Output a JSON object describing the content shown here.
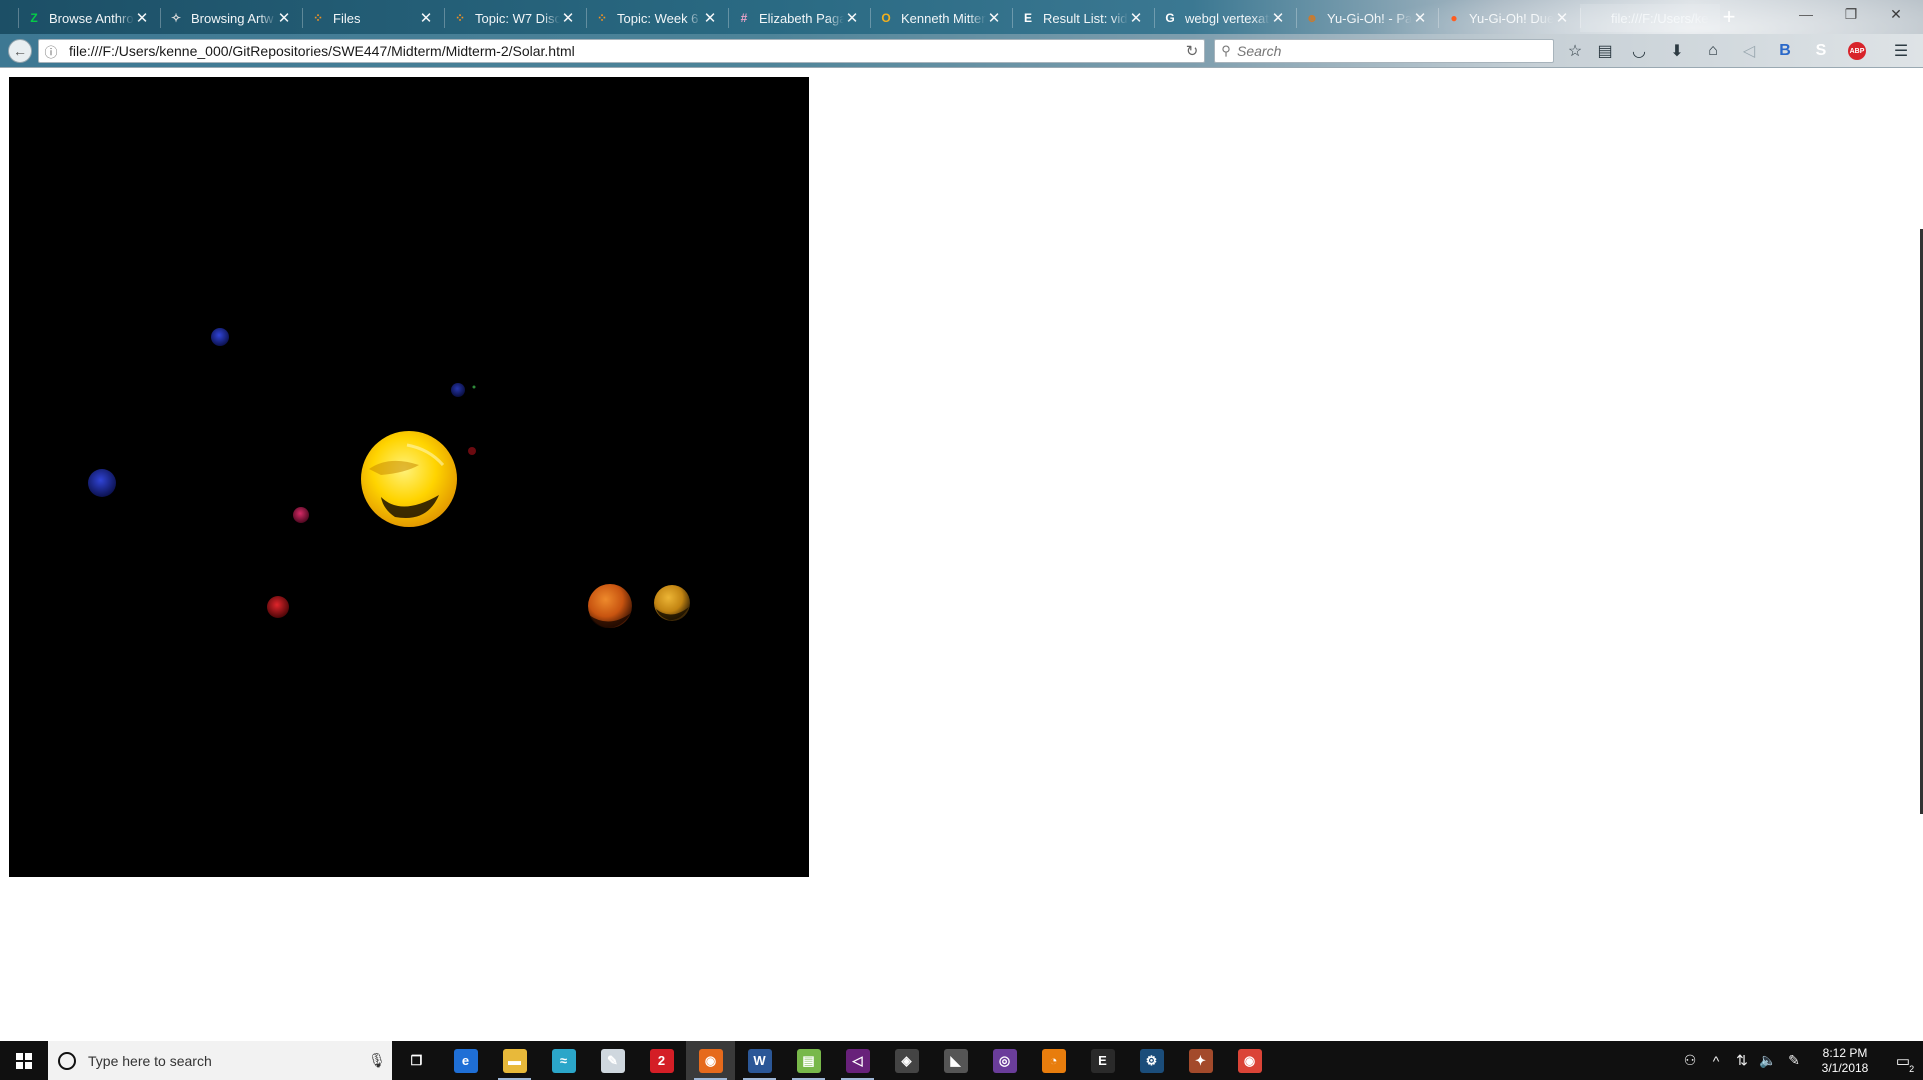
{
  "browser": {
    "tabs": [
      {
        "title": "Browse Anthro",
        "favicon": "deviantart-icon",
        "fav_glyph": "Z",
        "fav_color": "#05cc47",
        "active": false
      },
      {
        "title": "Browsing Artw",
        "favicon": "furaffinity-icon",
        "fav_glyph": "✧",
        "fav_color": "#dddddd",
        "active": false
      },
      {
        "title": "Files",
        "favicon": "d2l-icon",
        "fav_glyph": "⁘",
        "fav_color": "#f29222",
        "active": false
      },
      {
        "title": "Topic: W7 Disc",
        "favicon": "d2l-icon",
        "fav_glyph": "⁘",
        "fav_color": "#f29222",
        "active": false
      },
      {
        "title": "Topic: Week 6",
        "favicon": "d2l-icon",
        "fav_glyph": "⁘",
        "fav_color": "#f29222",
        "active": false
      },
      {
        "title": "Elizabeth Pagan",
        "favicon": "slack-icon",
        "fav_glyph": "#",
        "fav_color": "#e8a2c8",
        "active": false
      },
      {
        "title": "Kenneth Mitten",
        "favicon": "outlook-icon",
        "fav_glyph": "O",
        "fav_color": "#f2b01e",
        "active": false
      },
      {
        "title": "Result List: vid",
        "favicon": "ebsco-icon",
        "fav_glyph": "E",
        "fav_color": "#ffffff",
        "active": false
      },
      {
        "title": "webgl vertexatt",
        "favicon": "google-icon",
        "fav_glyph": "G",
        "fav_color": "#ffffff",
        "active": false
      },
      {
        "title": "Yu-Gi-Oh! - Pa",
        "favicon": "yugioh-icon",
        "fav_glyph": "☻",
        "fav_color": "#c97b2f",
        "active": false
      },
      {
        "title": "Yu-Gi-Oh! Due",
        "favicon": "reddit-icon",
        "fav_glyph": "●",
        "fav_color": "#ff4500",
        "active": false
      },
      {
        "title": "file:///F:/Users/ke",
        "favicon": "",
        "fav_glyph": "",
        "fav_color": "",
        "active": true
      }
    ],
    "url": "file:///F:/Users/kenne_000/GitRepositories/SWE447/Midterm/Midterm-2/Solar.html",
    "search_placeholder": "Search",
    "toolbar_icons": [
      "star-icon",
      "reading-list-icon",
      "pocket-icon",
      "download-icon",
      "home-icon",
      "share-icon",
      "extension-b-icon",
      "skype-icon",
      "adblock-icon",
      "menu-icon"
    ],
    "adblock_label": "ABP"
  },
  "scene": {
    "background": "#000000",
    "sun": {
      "color": "#ffd400"
    },
    "planets": [
      {
        "color": "#1a2bb8"
      },
      {
        "color": "#1b29a8"
      },
      {
        "color": "#1a2aa6"
      },
      {
        "color": "#c0164e"
      },
      {
        "color": "#d4161d"
      },
      {
        "color": "#8a0f14"
      },
      {
        "color": "#d15c10"
      },
      {
        "color": "#d49414"
      }
    ]
  },
  "taskbar": {
    "search_placeholder": "Type here to search",
    "apps": [
      {
        "name": "task-view-icon",
        "glyph": "❐",
        "bg": "transparent",
        "running": false,
        "active": false
      },
      {
        "name": "edge-icon",
        "glyph": "e",
        "bg": "#1f6fd6",
        "running": false,
        "active": false
      },
      {
        "name": "file-explorer-icon",
        "glyph": "▬",
        "bg": "#e8b93a",
        "running": true,
        "active": false
      },
      {
        "name": "dolphin-icon",
        "glyph": "≈",
        "bg": "#2ba6c9",
        "running": false,
        "active": false
      },
      {
        "name": "clip-studio-icon",
        "glyph": "✎",
        "bg": "#cfd7de",
        "running": false,
        "active": false
      },
      {
        "name": "pdf-app-icon",
        "glyph": "2",
        "bg": "#d41e26",
        "running": false,
        "active": false
      },
      {
        "name": "firefox-icon",
        "glyph": "◉",
        "bg": "#e66a1c",
        "running": true,
        "active": true
      },
      {
        "name": "word-icon",
        "glyph": "W",
        "bg": "#2b5797",
        "running": true,
        "active": false
      },
      {
        "name": "notepad-icon",
        "glyph": "▤",
        "bg": "#78b84a",
        "running": true,
        "active": false
      },
      {
        "name": "visual-studio-icon",
        "glyph": "◁",
        "bg": "#68217a",
        "running": true,
        "active": false
      },
      {
        "name": "unity-icon",
        "glyph": "◈",
        "bg": "#444444",
        "running": false,
        "active": false
      },
      {
        "name": "gamemaker-icon",
        "glyph": "◣",
        "bg": "#555555",
        "running": false,
        "active": false
      },
      {
        "name": "obs-icon",
        "glyph": "◎",
        "bg": "#6a3d9a",
        "running": false,
        "active": false
      },
      {
        "name": "blender-icon",
        "glyph": "◔",
        "bg": "#e87d0d",
        "running": false,
        "active": false
      },
      {
        "name": "epic-games-icon",
        "glyph": "E",
        "bg": "#2a2a2a",
        "running": false,
        "active": false
      },
      {
        "name": "steam-icon",
        "glyph": "⚙",
        "bg": "#1b4d7a",
        "running": false,
        "active": false
      },
      {
        "name": "game-icon",
        "glyph": "✦",
        "bg": "#a34a2b",
        "running": false,
        "active": false
      },
      {
        "name": "chrome-icon",
        "glyph": "◉",
        "bg": "#db4437",
        "running": false,
        "active": false
      }
    ],
    "time": "8:12 PM",
    "date": "3/1/2018",
    "notification_count": "2"
  }
}
